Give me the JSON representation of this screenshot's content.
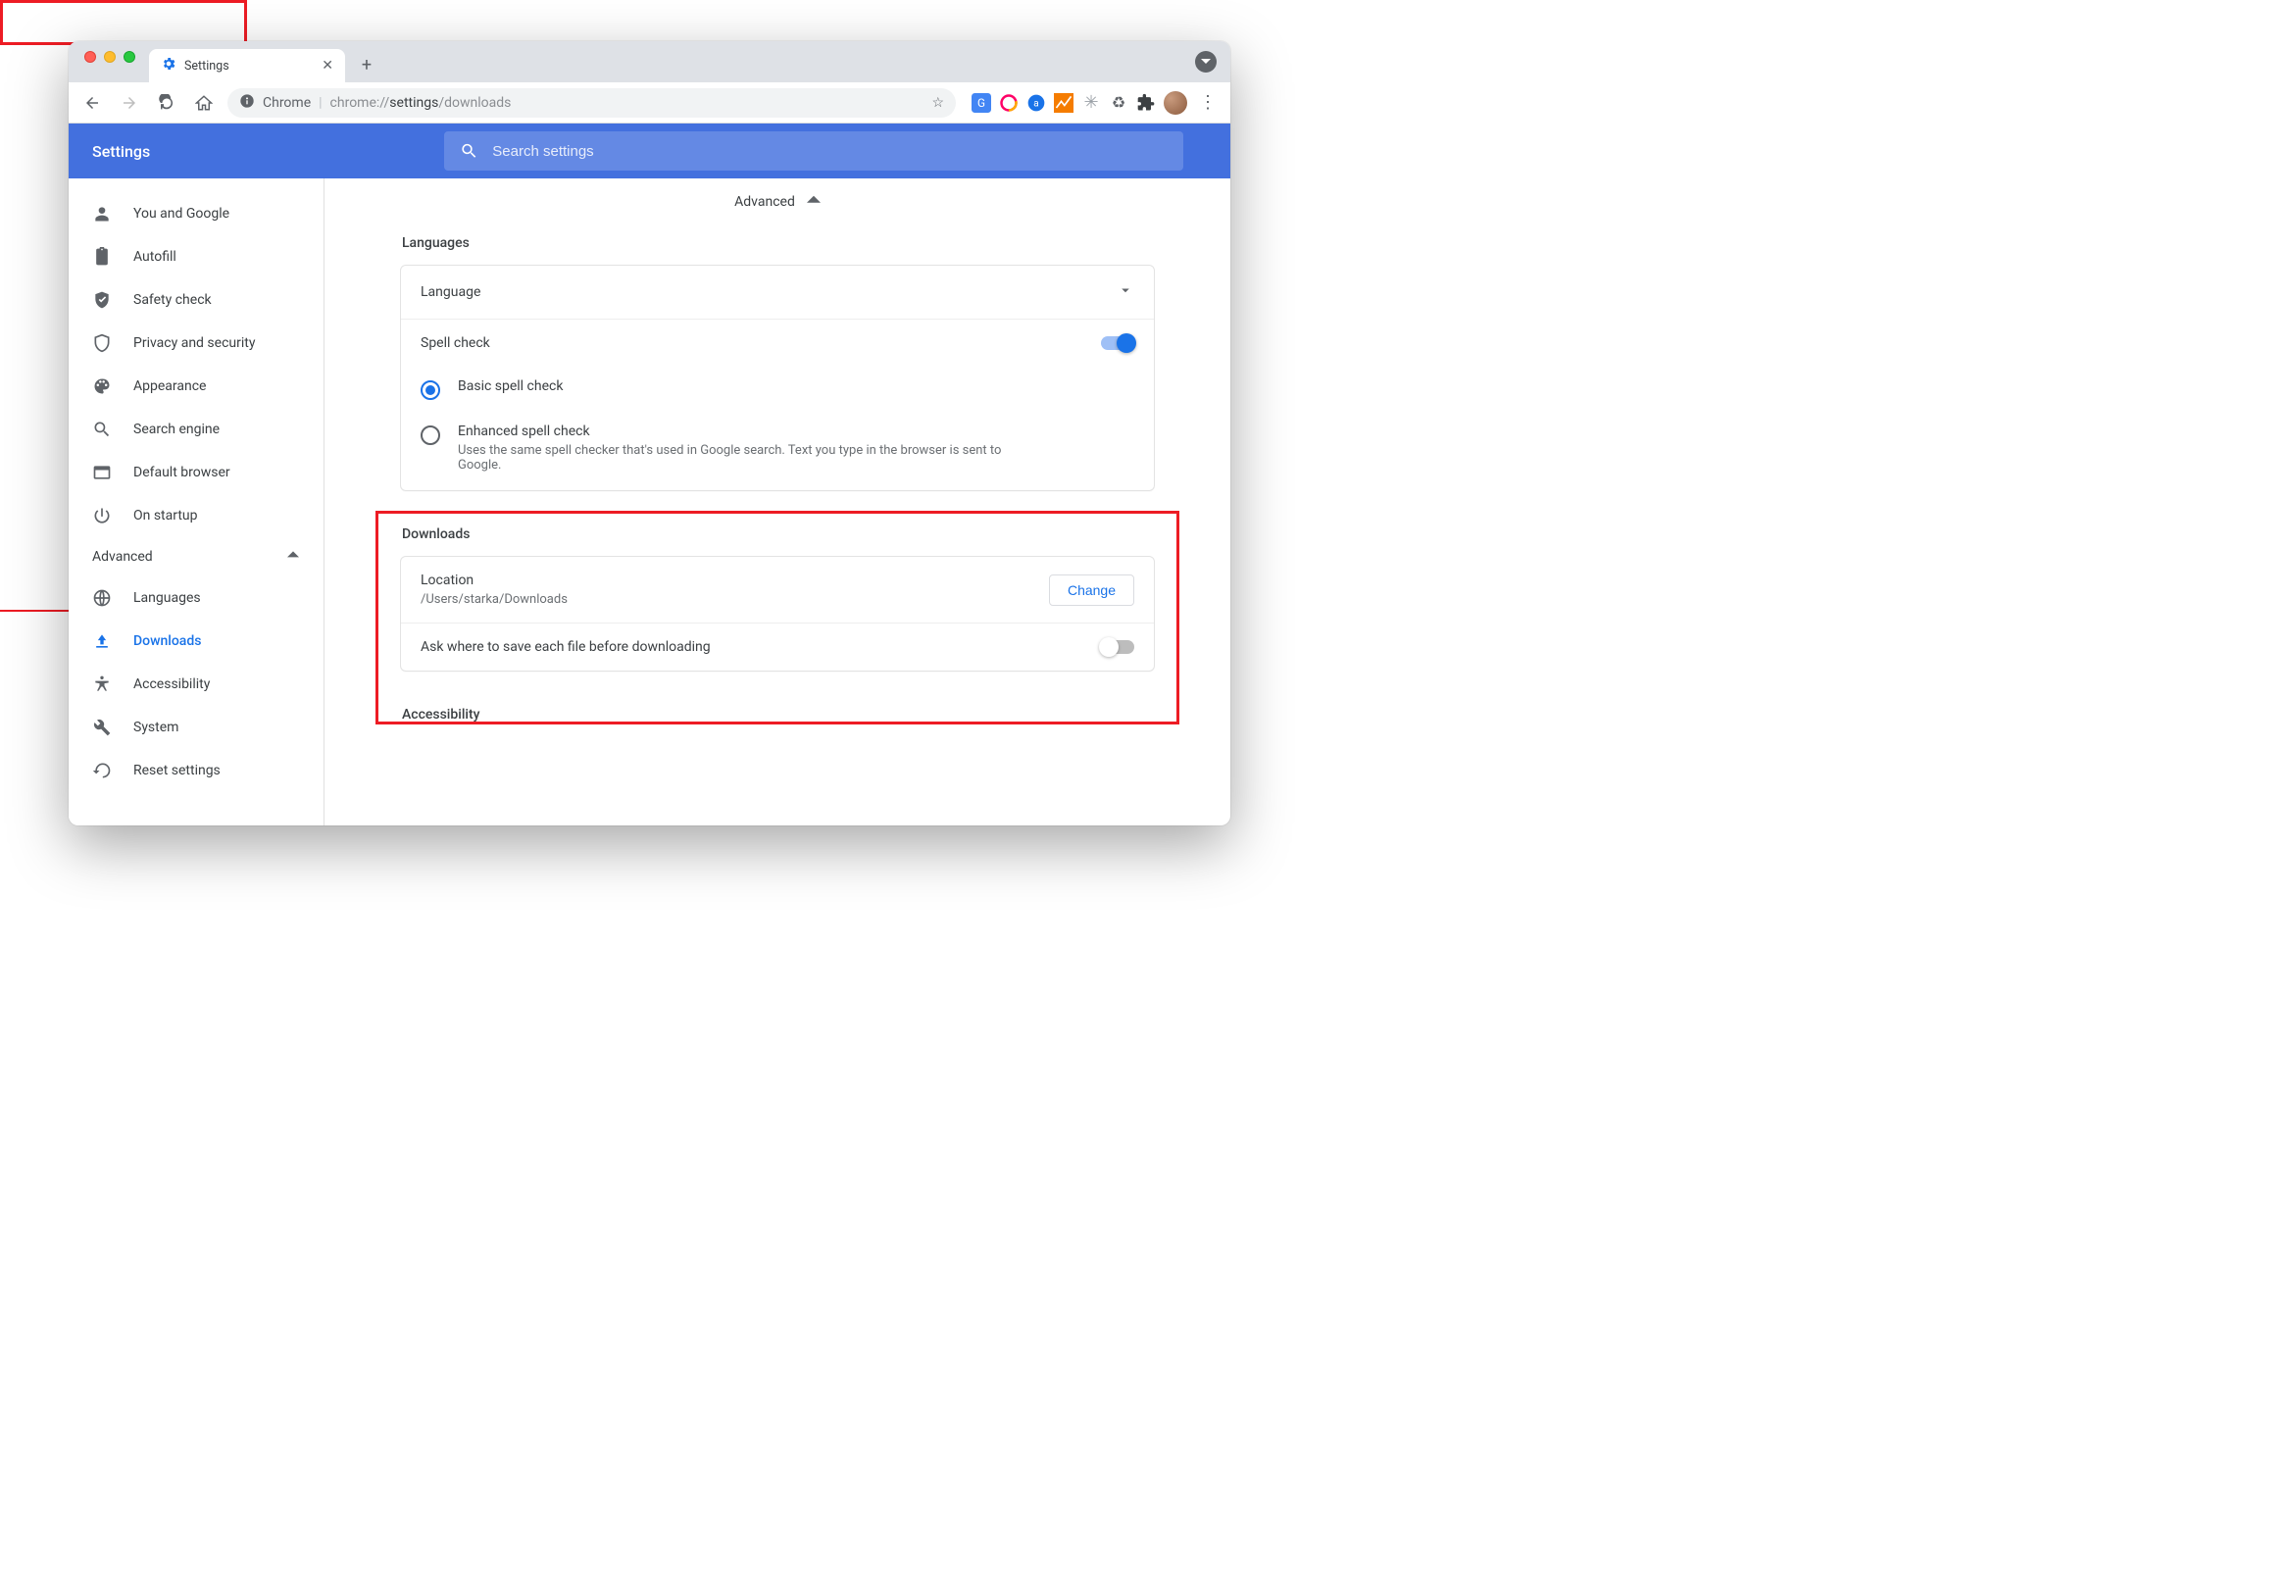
{
  "tab": {
    "title": "Settings"
  },
  "omnibox": {
    "chip": "Chrome",
    "url_prefix": "chrome://",
    "url_bold": "settings",
    "url_suffix": "/downloads"
  },
  "header": {
    "title": "Settings"
  },
  "search": {
    "placeholder": "Search settings"
  },
  "sidebar": {
    "items": [
      {
        "label": "You and Google"
      },
      {
        "label": "Autofill"
      },
      {
        "label": "Safety check"
      },
      {
        "label": "Privacy and security"
      },
      {
        "label": "Appearance"
      },
      {
        "label": "Search engine"
      },
      {
        "label": "Default browser"
      },
      {
        "label": "On startup"
      }
    ],
    "advanced_label": "Advanced",
    "advanced_items": [
      {
        "label": "Languages"
      },
      {
        "label": "Downloads"
      },
      {
        "label": "Accessibility"
      },
      {
        "label": "System"
      },
      {
        "label": "Reset settings"
      }
    ]
  },
  "main": {
    "advanced_header": "Advanced",
    "languages": {
      "heading": "Languages",
      "language_row": "Language",
      "spellcheck_row": "Spell check",
      "basic": "Basic spell check",
      "enhanced": "Enhanced spell check",
      "enhanced_desc": "Uses the same spell checker that's used in Google search. Text you type in the browser is sent to Google."
    },
    "downloads": {
      "heading": "Downloads",
      "location_label": "Location",
      "location_value": "/Users/starka/Downloads",
      "change_button": "Change",
      "ask_label": "Ask where to save each file before downloading"
    },
    "accessibility": {
      "heading": "Accessibility"
    }
  }
}
